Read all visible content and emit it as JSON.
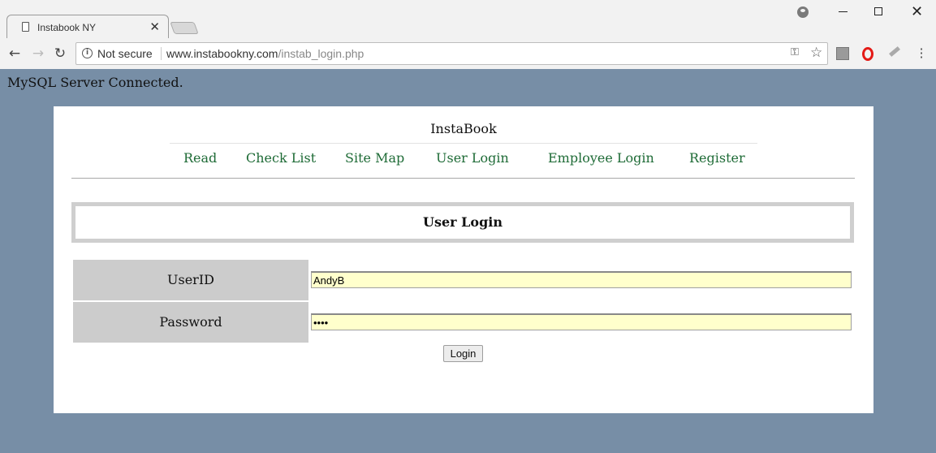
{
  "browser": {
    "tab_title": "Instabook NY",
    "omnibox": {
      "security_label": "Not secure",
      "url_host": "www.instabookny.com",
      "url_path": "/instab_login.php"
    },
    "colors": {
      "chrome_bg": "#f2f2f2",
      "opera_red": "#e41b17"
    }
  },
  "page": {
    "status_message": "MySQL Server Connected.",
    "site_title": "InstaBook",
    "nav": {
      "read": "Read",
      "check_list": "Check List",
      "site_map": "Site Map",
      "user_login": "User Login",
      "employee_login": "Employee Login",
      "register": "Register"
    },
    "login_heading": "User Login",
    "form": {
      "userid_label": "UserID",
      "userid_value": "AndyB",
      "password_label": "Password",
      "password_value": "••••",
      "submit_label": "Login"
    },
    "colors": {
      "page_bg": "#778ea6",
      "link": "#1e6b36",
      "input_bg": "#ffffcc",
      "label_bg": "#cccccc"
    }
  }
}
